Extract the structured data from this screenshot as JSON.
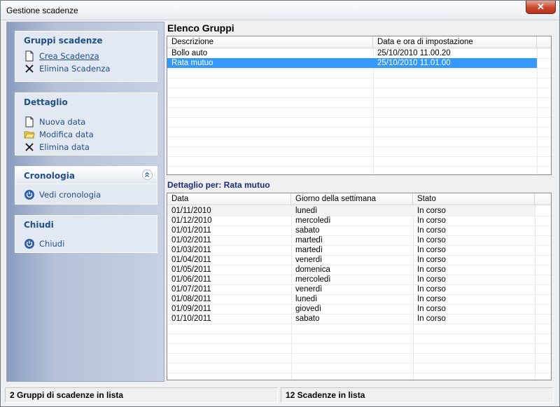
{
  "window": {
    "title": "Gestione scadenze",
    "close_label": "✕"
  },
  "sidebar": {
    "panel1": {
      "title": "Gruppi scadenze",
      "items": [
        {
          "label": "Crea Scadenza",
          "icon": "new-document-icon"
        },
        {
          "label": "Elimina Scadenza",
          "icon": "delete-x-icon"
        }
      ]
    },
    "panel2": {
      "title": "Dettaglio",
      "items": [
        {
          "label": "Nuova data",
          "icon": "new-document-icon"
        },
        {
          "label": "Modifica data",
          "icon": "open-folder-icon"
        },
        {
          "label": "Elimina data",
          "icon": "delete-x-icon"
        }
      ]
    },
    "panel3": {
      "title": "Cronologia",
      "items": [
        {
          "label": "Vedi cronologia",
          "icon": "power-icon"
        }
      ]
    },
    "panel4": {
      "title": "Chiudi",
      "items": [
        {
          "label": "Chiudi",
          "icon": "power-icon"
        }
      ]
    }
  },
  "gruppi": {
    "heading": "Elenco Gruppi",
    "columns": [
      "Descrizione",
      "Data e ora di impostazione"
    ],
    "rows": [
      [
        "Bollo auto",
        "25/10/2010 11.00.20"
      ],
      [
        "Rata mutuo",
        "25/10/2010 11.01.00"
      ]
    ],
    "selected_index": 1
  },
  "dettaglio": {
    "heading": "Dettaglio per: Rata mutuo",
    "columns": [
      "Data",
      "Giorno della settimana",
      "Stato"
    ],
    "rows": [
      [
        "01/11/2010",
        "lunedì",
        "In corso"
      ],
      [
        "01/12/2010",
        "mercoledì",
        "In corso"
      ],
      [
        "01/01/2011",
        "sabato",
        "In corso"
      ],
      [
        "01/02/2011",
        "martedì",
        "In corso"
      ],
      [
        "01/03/2011",
        "martedì",
        "In corso"
      ],
      [
        "01/04/2011",
        "venerdì",
        "In corso"
      ],
      [
        "01/05/2011",
        "domenica",
        "In corso"
      ],
      [
        "01/06/2011",
        "mercoledì",
        "In corso"
      ],
      [
        "01/07/2011",
        "venerdì",
        "In corso"
      ],
      [
        "01/08/2011",
        "lunedì",
        "In corso"
      ],
      [
        "01/09/2011",
        "giovedì",
        "In corso"
      ],
      [
        "01/10/2011",
        "sabato",
        "In corso"
      ]
    ]
  },
  "status": {
    "left": "2 Gruppi di scadenze in lista",
    "right": "12 Scadenze in lista"
  },
  "colors": {
    "accent": "#215089",
    "selection": "#3399ff",
    "heading_dark_blue": "#1c2d7a"
  }
}
